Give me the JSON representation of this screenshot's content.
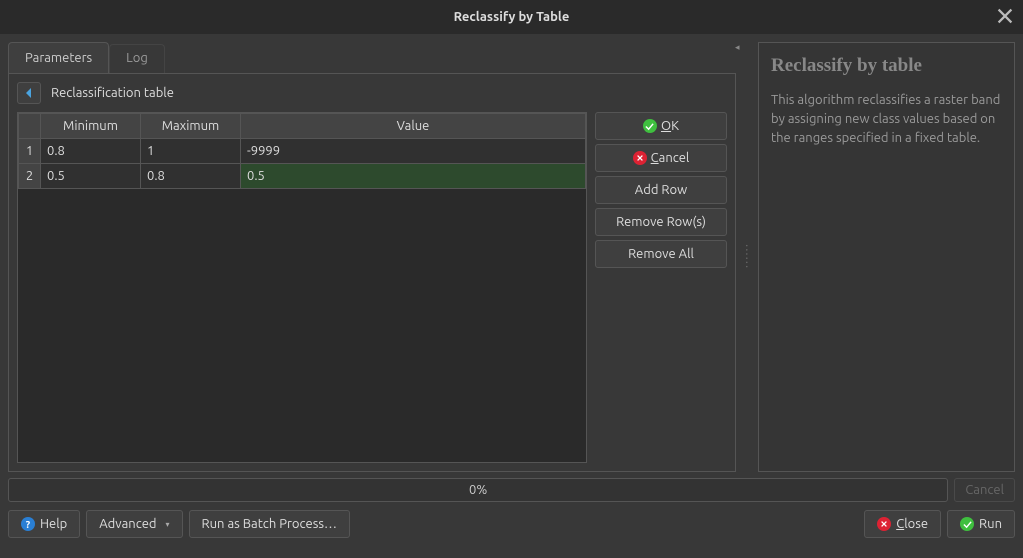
{
  "window": {
    "title": "Reclassify by Table"
  },
  "tabs": {
    "parameters": "Parameters",
    "log": "Log"
  },
  "sub": {
    "title": "Reclassification table"
  },
  "table": {
    "headers": {
      "minimum": "Minimum",
      "maximum": "Maximum",
      "value": "Value"
    },
    "rows": [
      {
        "num": "1",
        "min": "0.8",
        "max": "1",
        "val": "-9999"
      },
      {
        "num": "2",
        "min": "0.5",
        "max": "0.8",
        "val": "0.5"
      }
    ]
  },
  "side": {
    "ok": "OK",
    "cancel": "Cancel",
    "add": "Add Row",
    "remove": "Remove Row(s)",
    "removeall": "Remove All"
  },
  "help": {
    "title": "Reclassify by table",
    "body": "This algorithm reclassifies a raster band by assigning new class values based on the ranges specified in a fixed table."
  },
  "progress": {
    "pct": "0%",
    "cancel": "Cancel"
  },
  "bottom": {
    "help": "Help",
    "advanced": "Advanced",
    "batch": "Run as Batch Process…",
    "close": "Close",
    "run": "Run"
  }
}
